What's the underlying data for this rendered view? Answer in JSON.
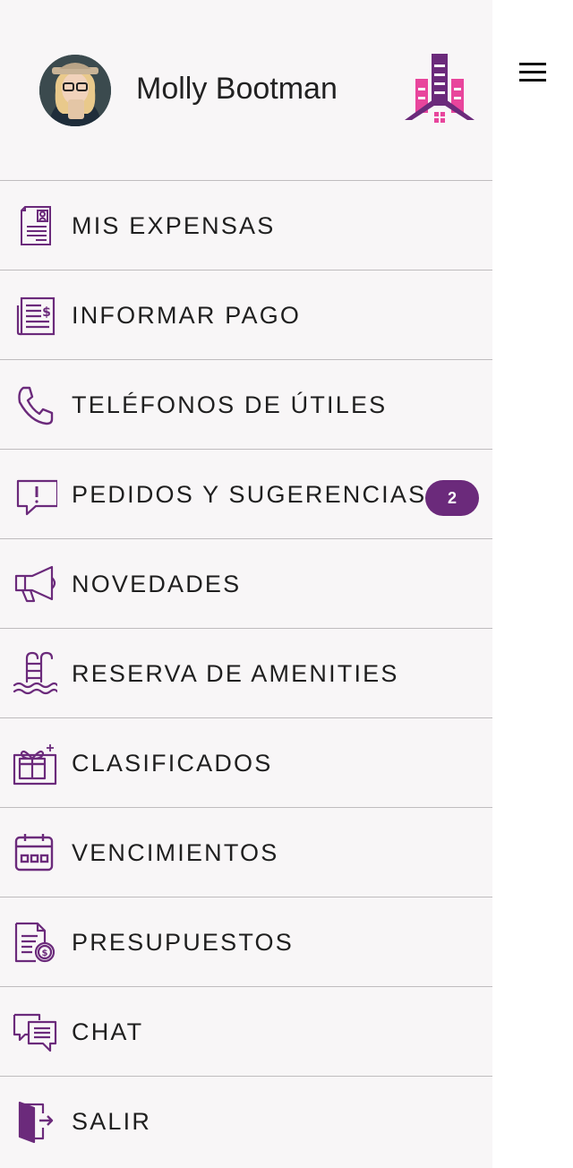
{
  "user": {
    "name": "Molly Bootman"
  },
  "colors": {
    "accent": "#6b2a7b",
    "brand_pink": "#e8459c",
    "drawer_bg": "#f8f6f7"
  },
  "menu": {
    "items": [
      {
        "label": "MIS EXPENSAS",
        "icon": "invoice-icon"
      },
      {
        "label": "INFORMAR PAGO",
        "icon": "payment-receipt-icon"
      },
      {
        "label": "TELÉFONOS DE ÚTILES",
        "icon": "phone-icon"
      },
      {
        "label": "PEDIDOS Y SUGERENCIAS",
        "icon": "alert-chat-icon",
        "badge": "2"
      },
      {
        "label": "NOVEDADES",
        "icon": "megaphone-icon"
      },
      {
        "label": "RESERVA DE AMENITIES",
        "icon": "pool-icon"
      },
      {
        "label": "CLASIFICADOS",
        "icon": "gift-shop-icon"
      },
      {
        "label": "VENCIMIENTOS",
        "icon": "calendar-icon"
      },
      {
        "label": "PRESUPUESTOS",
        "icon": "budget-document-icon"
      },
      {
        "label": "CHAT",
        "icon": "chat-icon"
      },
      {
        "label": "SALIR",
        "icon": "exit-door-icon"
      }
    ]
  }
}
